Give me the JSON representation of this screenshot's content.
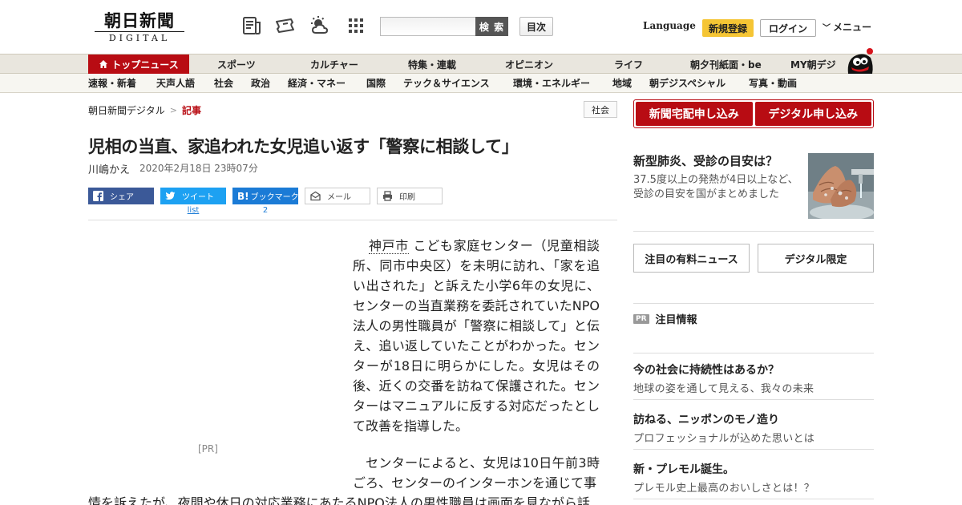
{
  "header": {
    "logo_main": "朝日新聞",
    "logo_sub": "DIGITAL",
    "search_button": "検 索",
    "toc_button": "目次",
    "language": "Language",
    "signup": "新規登録",
    "login": "ログイン",
    "menu": "メニュー",
    "icons": [
      "newspaper-icon",
      "ticket-icon",
      "weather-icon",
      "grid-icon"
    ]
  },
  "nav_primary": [
    "トップニュース",
    "スポーツ",
    "カルチャー",
    "特集・連載",
    "オピニオン",
    "ライフ",
    "朝夕刊紙面・be",
    "MY朝デジ"
  ],
  "nav_secondary": [
    "速報・新着",
    "天声人語",
    "社会",
    "政治",
    "経済・マネー",
    "国際",
    "テック＆サイエンス",
    "環境・エネルギー",
    "地域",
    "朝デジスペシャル",
    "写真・動画"
  ],
  "article": {
    "breadcrumb_home": "朝日新聞デジタル",
    "breadcrumb_sep": ">",
    "breadcrumb_current": "記事",
    "category": "社会",
    "headline": "児相の当直、家追われた女児追い返す「警察に相談して」",
    "author": "川嶋かえ",
    "date": "2020年2月18日 23時07分",
    "share": {
      "facebook": "シェア",
      "twitter": "ツイート",
      "twitter_count": "list",
      "hatena": "ブックマーク",
      "hatena_count": "2",
      "mail": "メール",
      "print": "印刷"
    },
    "ad_label": "[PR]",
    "place": "神戸市",
    "paragraph1_rest": "こども家庭センター（児童相談所、同市中央区）を未明に訪れ、「家を追い出された」と訴えた小学6年の女児に、センターの当直業務を委託されていたNPO法人の男性職員が「警察に相談して」と伝え、追い返していたことがわかった。センターが18日に明らかにした。女児はその後、近くの交番を訪ねて保護された。センターはマニュアルに反する対応だったとして改善を指導した。",
    "paragraph2_start": "センターによると、女児は10日午前3時ごろ、センターのインターホンを通じて事",
    "paragraph2_cont": "情を訴えたが、夜間や休日の対応業務にあたるNPO法人の男性職員は画面を見ながら話"
  },
  "sidebar": {
    "subscribe_paper": "新聞宅配申し込み",
    "subscribe_digital": "デジタル申し込み",
    "promo_title": "新型肺炎、受診の目安は？",
    "promo_desc": "37.5度以上の発熱が4日以上など、受診の目安を国がまとめました",
    "btn_paid_news": "注目の有料ニュース",
    "btn_digital_only": "デジタル限定",
    "pr_badge": "PR",
    "pr_heading": "注目情報",
    "pr_items": [
      {
        "title": "今の社会に持続性はあるか？",
        "desc": "地球の姿を通して見える、我々の未来"
      },
      {
        "title": "訪ねる、ニッポンのモノ造り",
        "desc": "プロフェッショナルが込めた思いとは"
      },
      {
        "title": "新・プレモル誕生。",
        "desc": "プレモル史上最高のおいしさとは！？"
      }
    ]
  },
  "colors": {
    "brand_red": "#b80c13",
    "signup_yellow": "#f5c534",
    "facebook": "#3b5998",
    "twitter": "#1da1f2",
    "hatena": "#1b7bd6"
  }
}
